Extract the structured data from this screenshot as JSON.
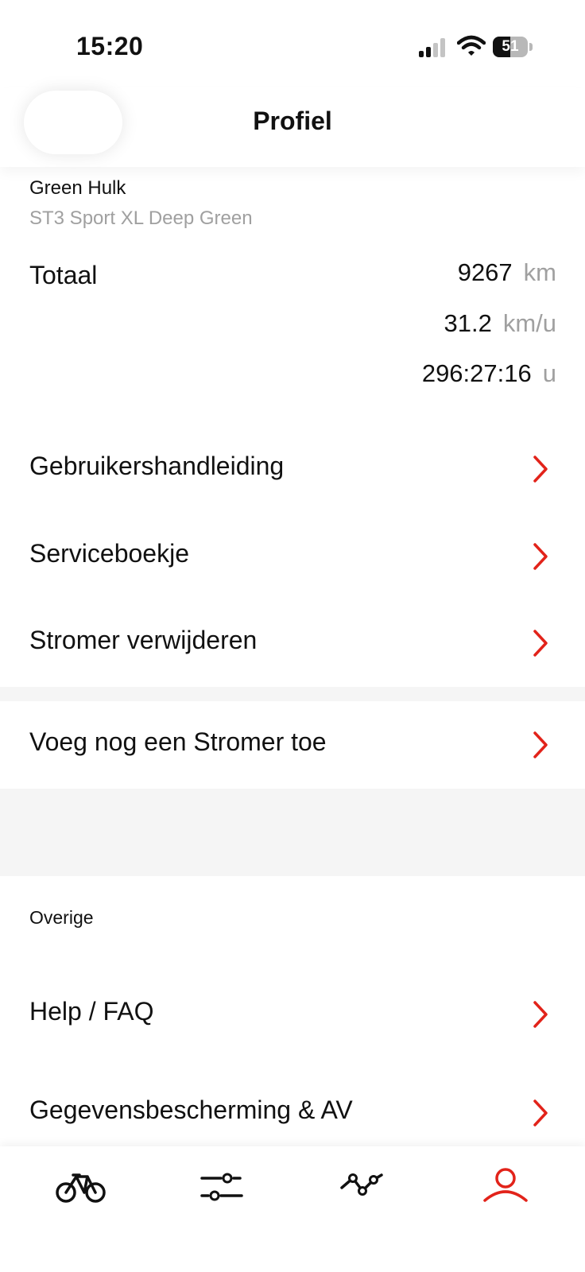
{
  "status_bar": {
    "time": "15:20",
    "battery_level": "51",
    "battery_fraction": 0.51,
    "signal_bars": 2,
    "icons": [
      "signal-icon",
      "wifi-icon",
      "battery-icon"
    ]
  },
  "header": {
    "title": "Profiel"
  },
  "bike": {
    "name": "Green Hulk",
    "model": "ST3 Sport XL Deep Green"
  },
  "stats": {
    "label": "Totaal",
    "distance": {
      "value": "9267",
      "unit": "km"
    },
    "speed": {
      "value": "31.2",
      "unit": "km/u"
    },
    "duration": {
      "value": "296:27:16",
      "unit": "u"
    }
  },
  "menu": {
    "manual": "Gebruikershandleiding",
    "service": "Serviceboekje",
    "remove": "Stromer verwijderen",
    "add": "Voeg nog een Stromer toe"
  },
  "other": {
    "section_label": "Overige",
    "help": "Help / FAQ",
    "privacy": "Gegevensbescherming & AV"
  },
  "tabs": {
    "active": "profile",
    "icons": [
      "bike-icon",
      "settings-sliders-icon",
      "trips-route-icon",
      "profile-icon"
    ]
  },
  "colors": {
    "accent": "#e2231a",
    "text": "#111111",
    "muted": "#a0a0a0",
    "separator": "#f5f5f5"
  }
}
